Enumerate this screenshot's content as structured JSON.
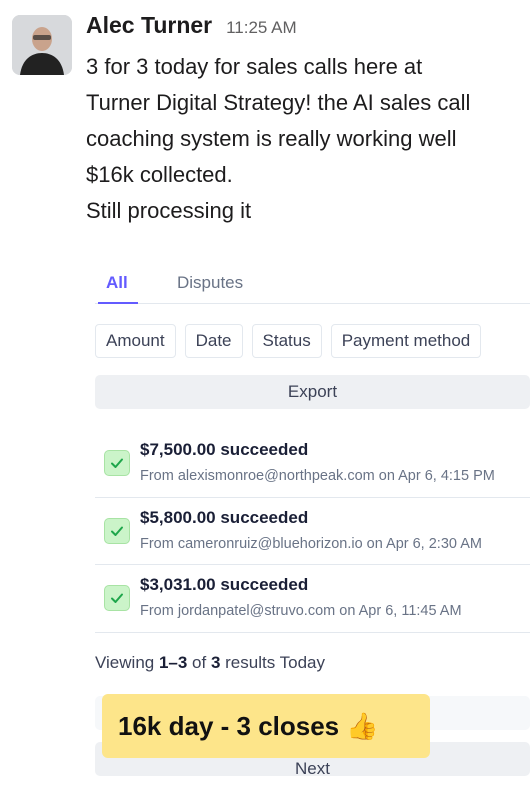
{
  "message": {
    "author": "Alec Turner",
    "time": "11:25 AM",
    "lines": [
      "3 for 3 today for sales calls here at",
      "Turner Digital Strategy! the AI sales call",
      "coaching system is really working well",
      "$16k collected.",
      "Still processing it"
    ]
  },
  "payments": {
    "tabs": [
      "All",
      "Disputes"
    ],
    "filters": [
      "Amount",
      "Date",
      "Status",
      "Payment method"
    ],
    "export_label": "Export",
    "transactions": [
      {
        "amount": "$7,500.00 succeeded",
        "meta": "From alexismonroe@northpeak.com on Apr 6, 4:15 PM"
      },
      {
        "amount": "$5,800.00 succeeded",
        "meta": "From cameronruiz@bluehorizon.io  on Apr 6, 2:30 AM"
      },
      {
        "amount": "$3,031.00 succeeded",
        "meta": "From jordanpatel@struvo.com on Apr 6, 11:45 AM"
      }
    ],
    "summary": {
      "prefix": "Viewing ",
      "range": "1–3",
      "mid": " of ",
      "total": "3",
      "suffix": " results Today"
    },
    "next_label": "Next"
  },
  "callout": {
    "text": "16k day - 3 closes 👍"
  },
  "colors": {
    "accent": "#635bff",
    "success_bg": "#cbf4c9",
    "success_check": "#1ea64b",
    "callout_bg": "#fde58a"
  }
}
